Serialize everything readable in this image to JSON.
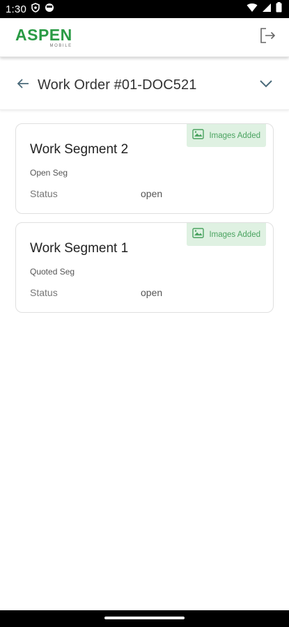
{
  "status_bar": {
    "time": "1:30",
    "icons": [
      "shield-icon",
      "face-icon",
      "wifi-icon",
      "signal-icon",
      "battery-icon"
    ]
  },
  "header": {
    "logo_main": "ASPEN",
    "logo_sub": "MOBILE",
    "logout_icon": "logout-icon",
    "brand_color": "#2a9b45"
  },
  "order": {
    "title": "Work Order #01-DOC521",
    "back_icon": "arrow-left-icon",
    "expand_icon": "chevron-down-icon"
  },
  "segments": [
    {
      "badge": "Images Added",
      "title": "Work Segment 2",
      "subtitle": "Open Seg",
      "status_label": "Status",
      "status_value": "open"
    },
    {
      "badge": "Images Added",
      "title": "Work Segment 1",
      "subtitle": "Quoted Seg",
      "status_label": "Status",
      "status_value": "open"
    }
  ],
  "colors": {
    "badge_bg": "#dff1e2",
    "badge_text": "#4aa360",
    "accent_icon": "#4a6a7a"
  }
}
